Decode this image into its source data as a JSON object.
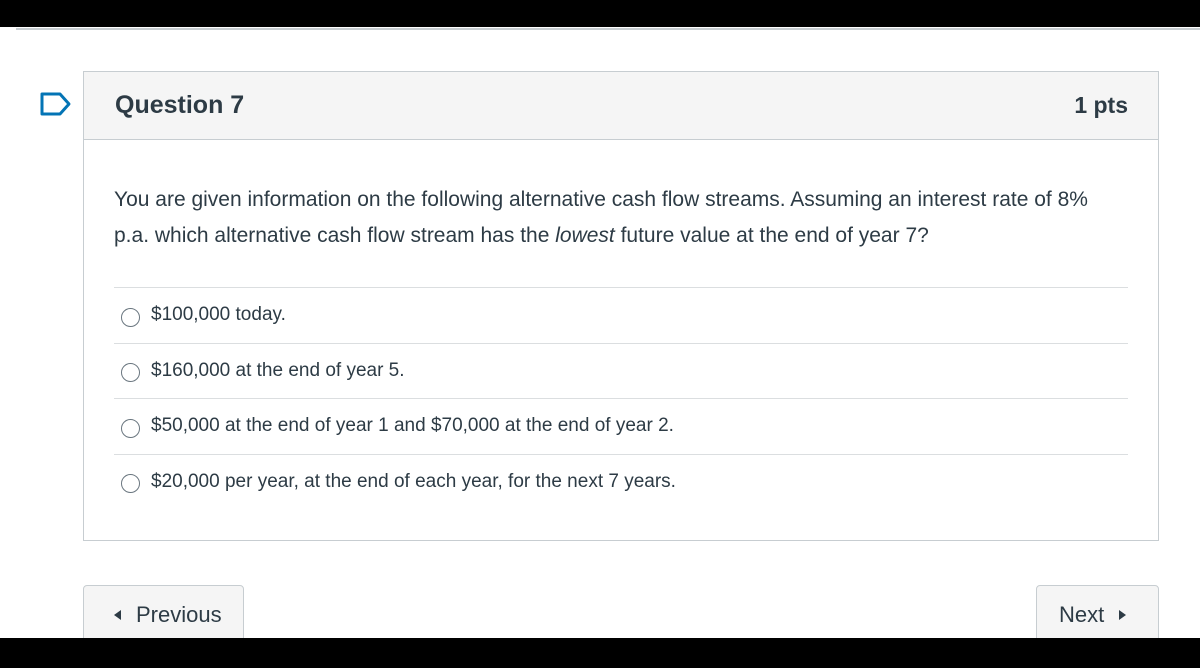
{
  "question": {
    "title": "Question 7",
    "points": "1 pts",
    "text_before": "You are given information on the following alternative cash flow streams. Assuming an interest rate of 8% p.a. which alternative cash flow stream has the ",
    "text_emphasis": "lowest",
    "text_after": " future value at the end of year 7?",
    "answers": [
      "$100,000 today.",
      "$160,000 at the end of year 5.",
      "$50,000 at the end of year 1 and $70,000 at the end of year 2.",
      "$20,000 per year, at the end of each year, for the next 7 years."
    ]
  },
  "navigation": {
    "previous_label": "Previous",
    "next_label": "Next"
  },
  "icons": {
    "flag": "flag-outline-icon",
    "previous": "triangle-left-icon",
    "next": "triangle-right-icon"
  },
  "colors": {
    "text": "#2d3b45",
    "border": "#c7cdd1",
    "header_bg": "#f5f5f5",
    "flag": "#0374b5"
  }
}
